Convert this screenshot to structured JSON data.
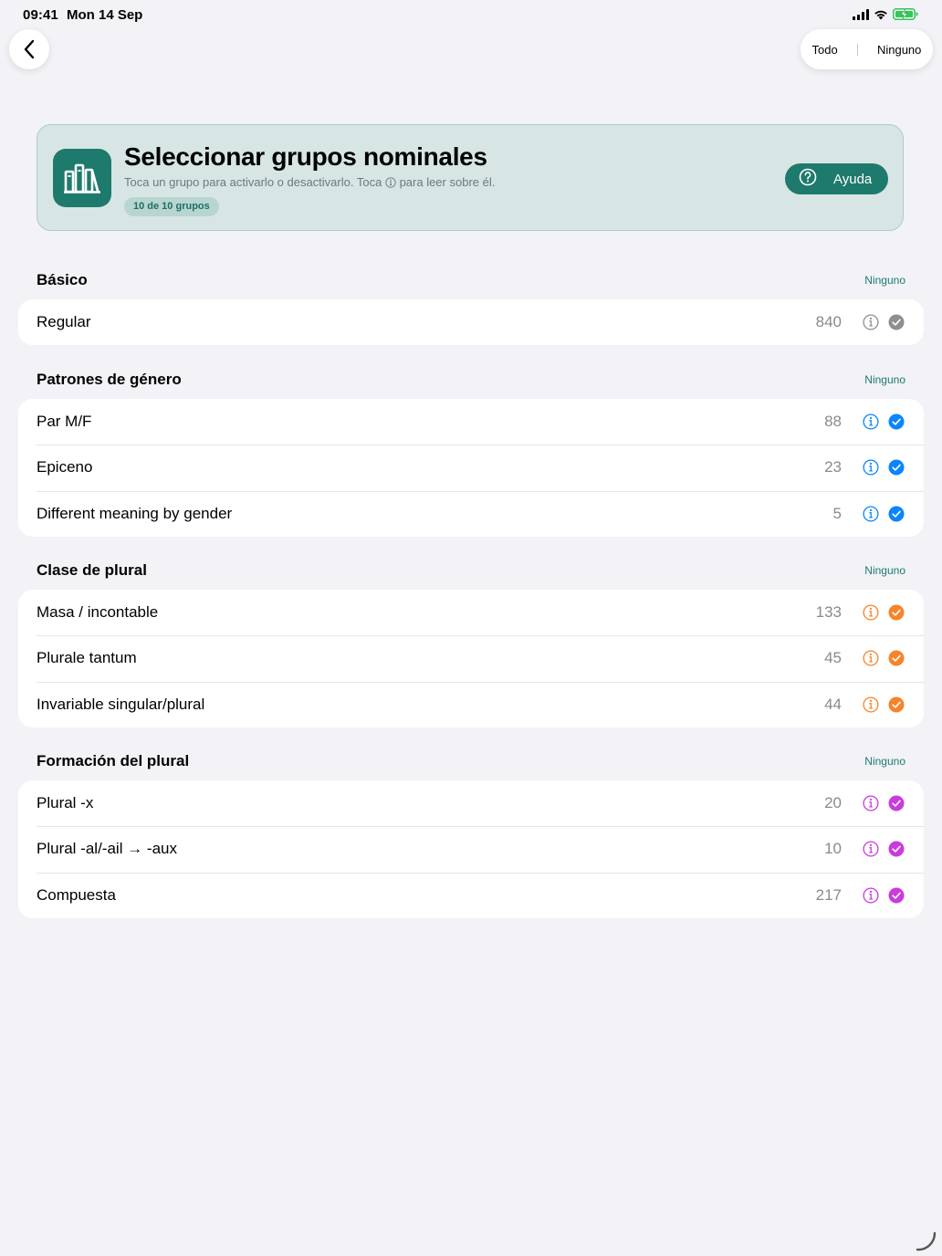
{
  "status_bar": {
    "time": "09:41",
    "date": "Mon 14 Sep"
  },
  "nav": {
    "todo_label": "Todo",
    "ninguno_label": "Ninguno"
  },
  "header": {
    "title": "Seleccionar grupos nominales",
    "subtitle_before": "Toca un grupo para activarlo o desactivarlo. Toca",
    "subtitle_after": "para leer sobre él.",
    "badge": "10 de 10 grupos",
    "help_label": "Ayuda"
  },
  "colors": {
    "brand": "#1e7a6c",
    "gray": "#8e8e93",
    "blue": "#0a84ff",
    "orange": "#f7832a",
    "purple": "#c93bdc"
  },
  "sections": [
    {
      "title": "Básico",
      "none_label": "Ninguno",
      "color": "gray",
      "items": [
        {
          "label": "Regular",
          "count": "840"
        }
      ]
    },
    {
      "title": "Patrones de género",
      "none_label": "Ninguno",
      "color": "blue",
      "items": [
        {
          "label": "Par M/F",
          "count": "88"
        },
        {
          "label": "Epiceno",
          "count": "23"
        },
        {
          "label": "Different meaning by gender",
          "count": "5"
        }
      ]
    },
    {
      "title": "Clase de plural",
      "none_label": "Ninguno",
      "color": "orange",
      "items": [
        {
          "label": "Masa / incontable",
          "count": "133"
        },
        {
          "label": "Plurale tantum",
          "count": "45"
        },
        {
          "label": "Invariable singular/plural",
          "count": "44"
        }
      ]
    },
    {
      "title": "Formación del plural",
      "none_label": "Ninguno",
      "color": "purple",
      "items": [
        {
          "label": "Plural -x",
          "count": "20"
        },
        {
          "label": "Plural -al/-ail → -aux",
          "count": "10"
        },
        {
          "label": "Compuesta",
          "count": "217"
        }
      ]
    }
  ]
}
